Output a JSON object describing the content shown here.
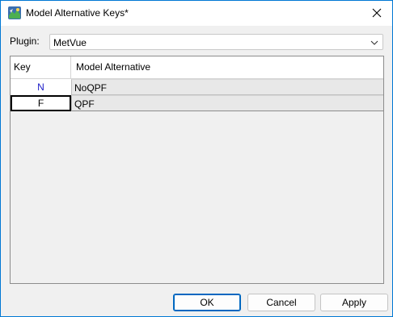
{
  "window": {
    "title": "Model Alternative Keys*",
    "icon": "app-icon",
    "close_icon": "close-icon"
  },
  "plugin": {
    "label": "Plugin:",
    "selected": "MetVue"
  },
  "table": {
    "columns": [
      "Key",
      "Model Alternative"
    ],
    "rows": [
      {
        "key": "N",
        "alternative": "NoQPF"
      },
      {
        "key": "F",
        "alternative": "QPF"
      }
    ]
  },
  "buttons": {
    "ok": "OK",
    "cancel": "Cancel",
    "apply": "Apply"
  },
  "colors": {
    "accent": "#0078d4",
    "key_text_blue": "#1b1bc8"
  }
}
